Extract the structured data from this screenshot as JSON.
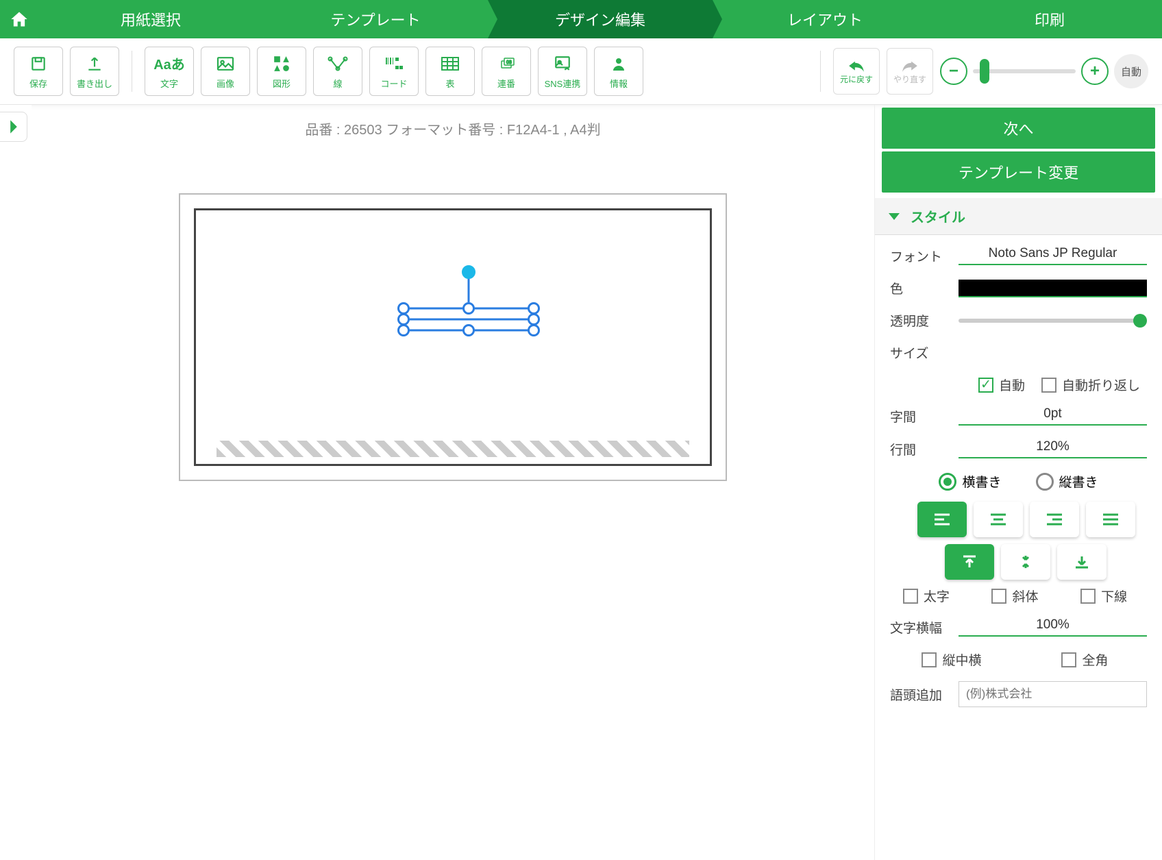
{
  "nav": {
    "steps": [
      "用紙選択",
      "テンプレート",
      "デザイン編集",
      "レイアウト",
      "印刷"
    ],
    "active_index": 2
  },
  "toolbar": {
    "save": "保存",
    "export": "書き出し",
    "text": "文字",
    "image": "画像",
    "shape": "図形",
    "line": "線",
    "code": "コード",
    "table": "表",
    "serial": "連番",
    "sns": "SNS連携",
    "info": "情報",
    "undo": "元に戻す",
    "redo": "やり直す",
    "zoom_auto": "自動"
  },
  "canvas": {
    "info": "品番 : 26503 フォーマット番号 : F12A4-1 , A4判"
  },
  "panel": {
    "next": "次へ",
    "change_template": "テンプレート変更",
    "style_header": "スタイル",
    "font_label": "フォント",
    "font_value": "Noto Sans JP Regular",
    "color_label": "色",
    "opacity_label": "透明度",
    "size_label": "サイズ",
    "auto": "自動",
    "auto_wrap": "自動折り返し",
    "letter_spacing_label": "字間",
    "letter_spacing_value": "0pt",
    "line_height_label": "行間",
    "line_height_value": "120%",
    "horizontal": "横書き",
    "vertical": "縦書き",
    "bold": "太字",
    "italic": "斜体",
    "underline": "下線",
    "char_width_label": "文字横幅",
    "char_width_value": "100%",
    "tatechuyoko": "縦中横",
    "fullwidth": "全角",
    "prefix_label": "語頭追加",
    "prefix_placeholder": "(例)株式会社"
  }
}
